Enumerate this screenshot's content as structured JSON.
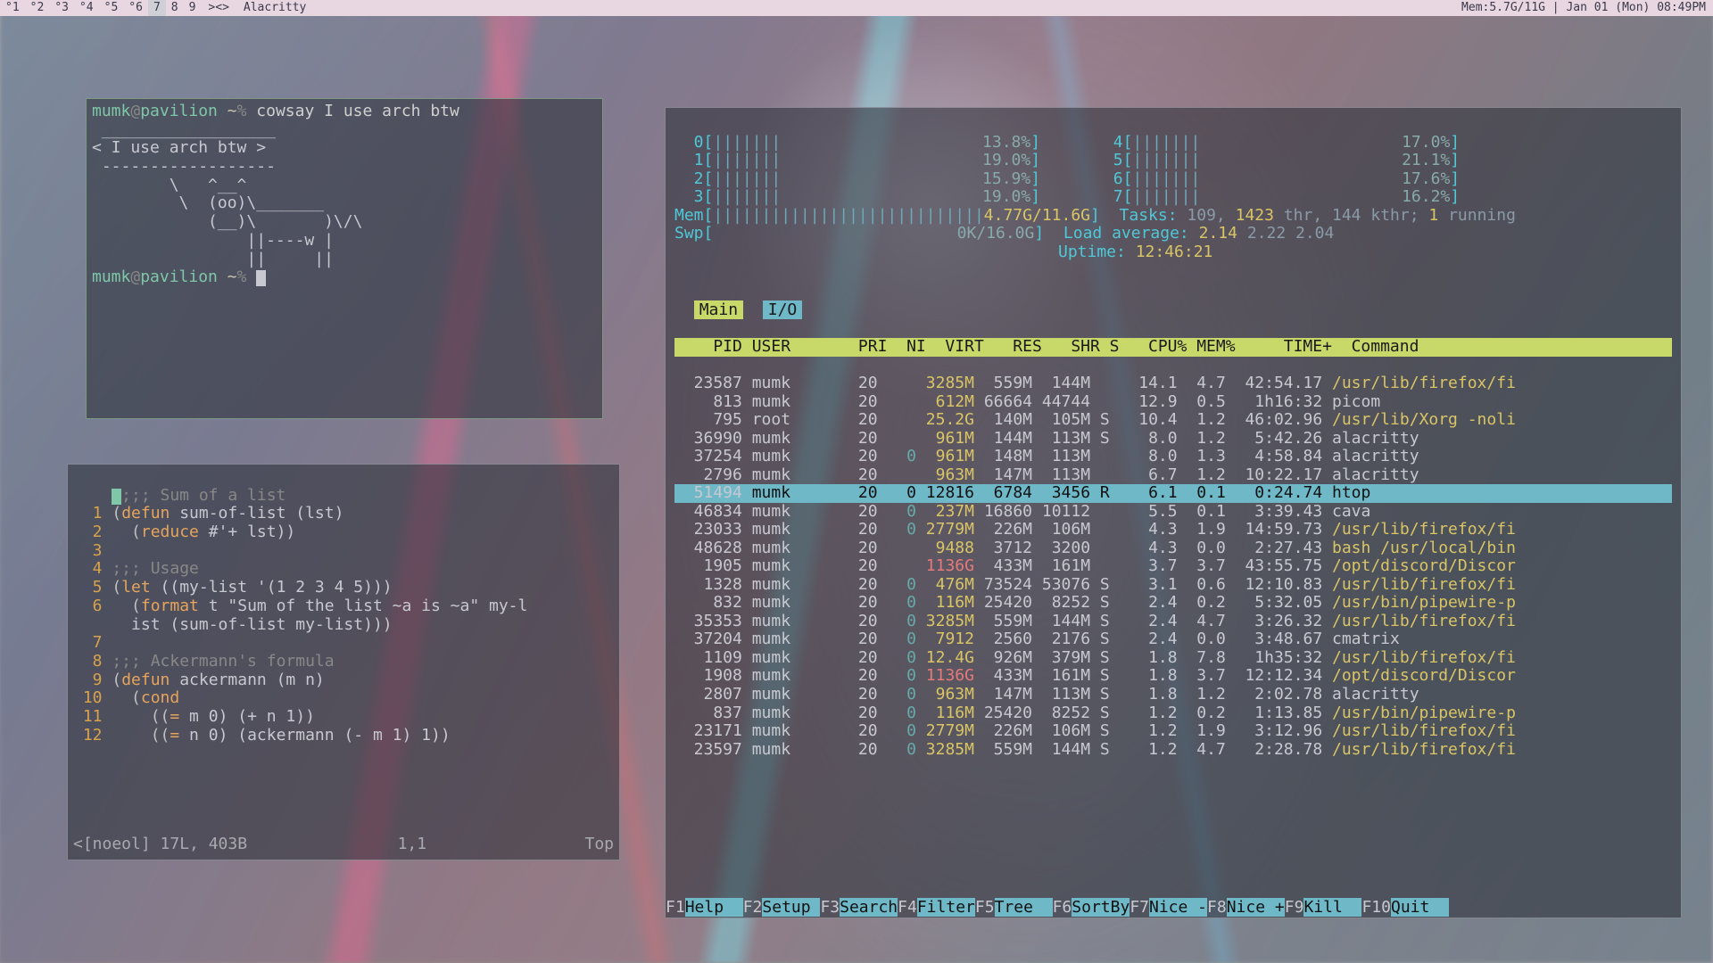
{
  "bar": {
    "tags": [
      "1",
      "2",
      "3",
      "4",
      "5",
      "6",
      "7",
      "8",
      "9"
    ],
    "layout_symbol": "><>",
    "title": "Alacritty",
    "mem": "Mem:5.7G/11G",
    "clock": "Jan 01 (Mon) 08:49PM"
  },
  "cowsay": {
    "prompt_user": "mumk",
    "prompt_host": "pavilion",
    "prompt_path": "~",
    "prompt_sym": "%",
    "command": "cowsay I use arch btw",
    "art": " __________________\n< I use arch btw >\n ------------------\n        \\   ^__^\n         \\  (oo)\\_______\n            (__)\\       )\\/\\\n                ||----w |\n                ||     ||"
  },
  "editor": {
    "lines": [
      {
        "n": " ",
        "text_a": ";;; Sum of a list",
        "cls": "comment"
      },
      {
        "n": "1",
        "raw": "(",
        "kw": "defun",
        "after": " sum-of-list (lst)"
      },
      {
        "n": "2",
        "indent": "  (",
        "kw": "reduce",
        "after": " #'+ lst))"
      },
      {
        "n": "3",
        "text_a": "",
        "cls": ""
      },
      {
        "n": "4",
        "text_a": ";;; Usage",
        "cls": "comment"
      },
      {
        "n": "5",
        "raw": "(",
        "kw": "let",
        "after": " ((my-list '(1 2 3 4 5)))"
      },
      {
        "n": "6",
        "indent": "  (",
        "kw": "format",
        "after": " t \"Sum of the list ~a is ~a\" my-l"
      },
      {
        "n": " ",
        "text_a": "  ist (sum-of-list my-list)))",
        "cls": ""
      },
      {
        "n": "7",
        "text_a": "",
        "cls": ""
      },
      {
        "n": "8",
        "text_a": ";;; Ackermann's formula",
        "cls": "comment"
      },
      {
        "n": "9",
        "raw": "(",
        "kw": "defun",
        "after": " ackermann (m n)"
      },
      {
        "n": "10",
        "indent": "  (",
        "kw": "cond",
        "after": ""
      },
      {
        "n": "11",
        "indent": "    ((",
        "kw": "=",
        "after": " m 0) (+ n 1))"
      },
      {
        "n": "12",
        "indent": "    ((",
        "kw": "=",
        "after": " n 0) (ackermann (- m 1) 1))"
      }
    ],
    "status_left": "<[noeol] 17L, 403B",
    "status_mid": "1,1",
    "status_right": "Top"
  },
  "htop": {
    "cpus": [
      {
        "id": "0",
        "pct": "13.8%"
      },
      {
        "id": "1",
        "pct": "19.0%"
      },
      {
        "id": "2",
        "pct": "15.9%"
      },
      {
        "id": "3",
        "pct": "19.0%"
      },
      {
        "id": "4",
        "pct": "17.0%"
      },
      {
        "id": "5",
        "pct": "21.1%"
      },
      {
        "id": "6",
        "pct": "17.6%"
      },
      {
        "id": "7",
        "pct": "16.2%"
      }
    ],
    "mem": "4.77G/11.6G",
    "swp": "0K/16.0G",
    "tasks": "Tasks: 109, 1423 thr, 144 kthr; 1 running",
    "loadavg": "Load average: 2.14 2.22 2.04",
    "uptime": "Uptime: 12:46:21",
    "tabs": [
      "Main",
      "I/O"
    ],
    "header": "    PID USER       PRI  NI  VIRT   RES   SHR S   CPU% MEM%     TIME+  Command",
    "rows": [
      {
        "pid": "23587",
        "user": "mumk",
        "pri": "20",
        "ni": "",
        "virt": "3285M",
        "res": "559M",
        "shr": "144M",
        "s": "",
        "cpu": "14.1",
        "mem": "4.7",
        "time": "42:54.17",
        "cmd": "/usr/lib/firefox/fi",
        "red": false
      },
      {
        "pid": "813",
        "user": "mumk",
        "pri": "20",
        "ni": "",
        "virt": "612M",
        "res": "66664",
        "shr": "44744",
        "s": "",
        "cpu": "12.9",
        "mem": "0.5",
        "time": "1h16:32",
        "cmd": "picom",
        "red": false,
        "cmdw": true
      },
      {
        "pid": "795",
        "user": "root",
        "pri": "20",
        "ni": "",
        "virt": "25.2G",
        "res": "140M",
        "shr": "105M",
        "s": "S",
        "cpu": "10.4",
        "mem": "1.2",
        "time": "46:02.96",
        "cmd": "/usr/lib/Xorg -noli",
        "red": false
      },
      {
        "pid": "36990",
        "user": "mumk",
        "pri": "20",
        "ni": "",
        "virt": "961M",
        "res": "144M",
        "shr": "113M",
        "s": "S",
        "cpu": "8.0",
        "mem": "1.2",
        "time": "5:42.26",
        "cmd": "alacritty",
        "red": false,
        "cmdw": true
      },
      {
        "pid": "37254",
        "user": "mumk",
        "pri": "20",
        "ni": "0",
        "virt": "961M",
        "res": "148M",
        "shr": "113M",
        "s": "",
        "cpu": "8.0",
        "mem": "1.3",
        "time": "4:58.84",
        "cmd": "alacritty",
        "red": false,
        "cmdw": true
      },
      {
        "pid": "2796",
        "user": "mumk",
        "pri": "20",
        "ni": "",
        "virt": "963M",
        "res": "147M",
        "shr": "113M",
        "s": "",
        "cpu": "6.7",
        "mem": "1.2",
        "time": "10:22.17",
        "cmd": "alacritty",
        "red": false,
        "cmdw": true
      },
      {
        "pid": "51494",
        "user": "mumk",
        "pri": "20",
        "ni": "0",
        "virt": "12816",
        "res": "6784",
        "shr": "3456",
        "s": "R",
        "cpu": "6.1",
        "mem": "0.1",
        "time": "0:24.74",
        "cmd": "htop",
        "sel": true
      },
      {
        "pid": "46834",
        "user": "mumk",
        "pri": "20",
        "ni": "0",
        "virt": "237M",
        "res": "16860",
        "shr": "10112",
        "s": "",
        "cpu": "5.5",
        "mem": "0.1",
        "time": "3:39.43",
        "cmd": "cava",
        "red": false,
        "cmdw": true
      },
      {
        "pid": "23033",
        "user": "mumk",
        "pri": "20",
        "ni": "0",
        "virt": "2779M",
        "res": "226M",
        "shr": "106M",
        "s": "",
        "cpu": "4.3",
        "mem": "1.9",
        "time": "14:59.73",
        "cmd": "/usr/lib/firefox/fi",
        "red": false
      },
      {
        "pid": "48628",
        "user": "mumk",
        "pri": "20",
        "ni": "",
        "virt": "9488",
        "res": "3712",
        "shr": "3200",
        "s": "",
        "cpu": "4.3",
        "mem": "0.0",
        "time": "2:27.43",
        "cmd": "bash /usr/local/bin",
        "red": false
      },
      {
        "pid": "1905",
        "user": "mumk",
        "pri": "20",
        "ni": "",
        "virt": "1136G",
        "res": "433M",
        "shr": "161M",
        "s": "",
        "cpu": "3.7",
        "mem": "3.7",
        "time": "43:55.75",
        "cmd": "/opt/discord/Discor",
        "red": true
      },
      {
        "pid": "1328",
        "user": "mumk",
        "pri": "20",
        "ni": "0",
        "virt": "476M",
        "res": "73524",
        "shr": "53076",
        "s": "S",
        "cpu": "3.1",
        "mem": "0.6",
        "time": "12:10.83",
        "cmd": "/usr/lib/firefox/fi",
        "red": false
      },
      {
        "pid": "832",
        "user": "mumk",
        "pri": "20",
        "ni": "0",
        "virt": "116M",
        "res": "25420",
        "shr": "8252",
        "s": "S",
        "cpu": "2.4",
        "mem": "0.2",
        "time": "5:32.05",
        "cmd": "/usr/bin/pipewire-p",
        "red": false
      },
      {
        "pid": "35353",
        "user": "mumk",
        "pri": "20",
        "ni": "0",
        "virt": "3285M",
        "res": "559M",
        "shr": "144M",
        "s": "S",
        "cpu": "2.4",
        "mem": "4.7",
        "time": "3:26.32",
        "cmd": "/usr/lib/firefox/fi",
        "red": false
      },
      {
        "pid": "37204",
        "user": "mumk",
        "pri": "20",
        "ni": "0",
        "virt": "7912",
        "res": "2560",
        "shr": "2176",
        "s": "S",
        "cpu": "2.4",
        "mem": "0.0",
        "time": "3:48.67",
        "cmd": "cmatrix",
        "red": false,
        "cmdw": true
      },
      {
        "pid": "1109",
        "user": "mumk",
        "pri": "20",
        "ni": "0",
        "virt": "12.4G",
        "res": "926M",
        "shr": "379M",
        "s": "S",
        "cpu": "1.8",
        "mem": "7.8",
        "time": "1h35:32",
        "cmd": "/usr/lib/firefox/fi",
        "red": false
      },
      {
        "pid": "1908",
        "user": "mumk",
        "pri": "20",
        "ni": "0",
        "virt": "1136G",
        "res": "433M",
        "shr": "161M",
        "s": "S",
        "cpu": "1.8",
        "mem": "3.7",
        "time": "12:12.34",
        "cmd": "/opt/discord/Discor",
        "red": true
      },
      {
        "pid": "2807",
        "user": "mumk",
        "pri": "20",
        "ni": "0",
        "virt": "963M",
        "res": "147M",
        "shr": "113M",
        "s": "S",
        "cpu": "1.8",
        "mem": "1.2",
        "time": "2:02.78",
        "cmd": "alacritty",
        "red": false,
        "cmdw": true
      },
      {
        "pid": "837",
        "user": "mumk",
        "pri": "20",
        "ni": "0",
        "virt": "116M",
        "res": "25420",
        "shr": "8252",
        "s": "S",
        "cpu": "1.2",
        "mem": "0.2",
        "time": "1:13.85",
        "cmd": "/usr/bin/pipewire-p",
        "red": false
      },
      {
        "pid": "23171",
        "user": "mumk",
        "pri": "20",
        "ni": "0",
        "virt": "2779M",
        "res": "226M",
        "shr": "106M",
        "s": "S",
        "cpu": "1.2",
        "mem": "1.9",
        "time": "3:12.96",
        "cmd": "/usr/lib/firefox/fi",
        "red": false
      },
      {
        "pid": "23597",
        "user": "mumk",
        "pri": "20",
        "ni": "0",
        "virt": "3285M",
        "res": "559M",
        "shr": "144M",
        "s": "S",
        "cpu": "1.2",
        "mem": "4.7",
        "time": "2:28.78",
        "cmd": "/usr/lib/firefox/fi",
        "red": false
      }
    ],
    "footer": [
      {
        "k": "F1",
        "l": "Help  "
      },
      {
        "k": "F2",
        "l": "Setup "
      },
      {
        "k": "F3",
        "l": "Search"
      },
      {
        "k": "F4",
        "l": "Filter"
      },
      {
        "k": "F5",
        "l": "Tree  "
      },
      {
        "k": "F6",
        "l": "SortBy"
      },
      {
        "k": "F7",
        "l": "Nice -"
      },
      {
        "k": "F8",
        "l": "Nice +"
      },
      {
        "k": "F9",
        "l": "Kill  "
      },
      {
        "k": "F10",
        "l": "Quit  "
      }
    ]
  }
}
